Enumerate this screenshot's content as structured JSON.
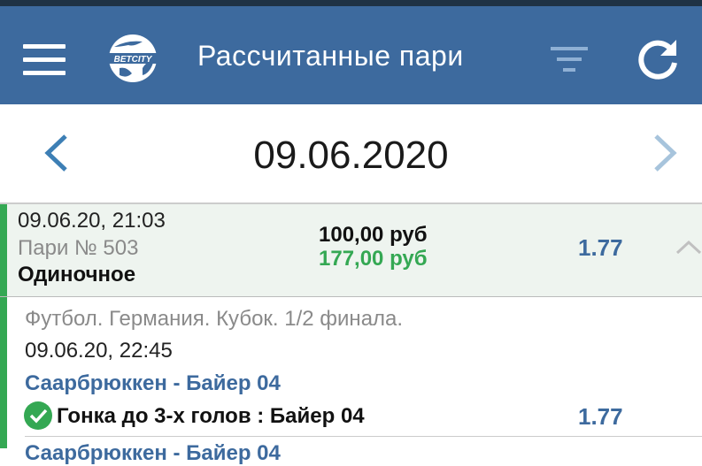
{
  "colors": {
    "appbar": "#3d6a9e",
    "accent_green": "#34a853",
    "link_blue": "#3d6a9e",
    "arrow_blue": "#3d7fb5",
    "arrow_light": "#a7c4dc"
  },
  "header": {
    "title": "Рассчитанные пари",
    "logo_text": "BETCITY",
    "icons": [
      "menu-icon",
      "filter-icon",
      "refresh-icon"
    ]
  },
  "date_nav": {
    "date": "09.06.2020",
    "icons": [
      "chevron-left-icon",
      "chevron-right-icon"
    ]
  },
  "bet": {
    "datetime": "09.06.20, 21:03",
    "number": "Пари № 503",
    "type": "Одиночное",
    "stake": "100,00 руб",
    "payout": "177,00 руб",
    "odds": "1.77",
    "status": "won"
  },
  "event": {
    "league": "Футбол. Германия. Кубок. 1/2 финала.",
    "datetime": "09.06.20, 22:45",
    "teams": "Саарбрюккен - Байер 04",
    "pick": "Гонка до 3-х голов : Байер 04",
    "pick_odds": "1.77",
    "next_teams_partial": "Саарбрюккен - Байер 04"
  }
}
